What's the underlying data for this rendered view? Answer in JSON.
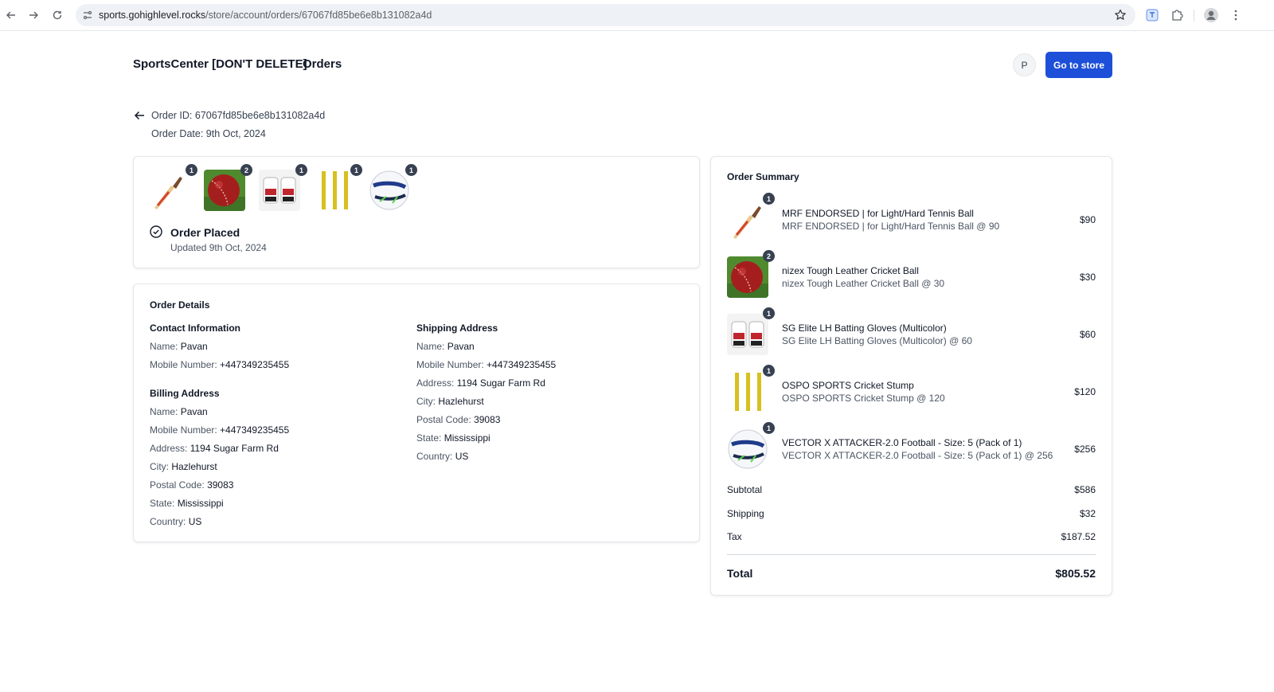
{
  "browser": {
    "url_host": "sports.gohighlevel.rocks",
    "url_path": "/store/account/orders/67067fd85be6e8b131082a4d"
  },
  "header": {
    "brand": "SportsCenter [DON'T DELETE]",
    "orders_link": "Orders",
    "avatar_initial": "P",
    "go_to_store": "Go to store"
  },
  "order": {
    "id_line": "Order ID: 67067fd85be6e8b131082a4d",
    "date_line": "Order Date: 9th Oct, 2024"
  },
  "status": {
    "title": "Order Placed",
    "updated": "Updated 9th Oct, 2024",
    "quantities": [
      "1",
      "2",
      "1",
      "1",
      "1"
    ]
  },
  "details": {
    "title": "Order Details",
    "contact": {
      "heading": "Contact Information",
      "name_label": "Name:",
      "name": "Pavan",
      "mobile_label": "Mobile Number:",
      "mobile": "+447349235455"
    },
    "billing": {
      "heading": "Billing Address",
      "name_label": "Name:",
      "name": "Pavan",
      "mobile_label": "Mobile Number:",
      "mobile": "+447349235455",
      "address_label": "Address:",
      "address": "1194 Sugar Farm Rd",
      "city_label": "City:",
      "city": "Hazlehurst",
      "postal_label": "Postal Code:",
      "postal": "39083",
      "state_label": "State:",
      "state": "Mississippi",
      "country_label": "Country:",
      "country": "US"
    },
    "shipping": {
      "heading": "Shipping Address",
      "name_label": "Name:",
      "name": "Pavan",
      "mobile_label": "Mobile Number:",
      "mobile": "+447349235455",
      "address_label": "Address:",
      "address": "1194 Sugar Farm Rd",
      "city_label": "City:",
      "city": "Hazlehurst",
      "postal_label": "Postal Code:",
      "postal": "39083",
      "state_label": "State:",
      "state": "Mississippi",
      "country_label": "Country:",
      "country": "US"
    }
  },
  "summary": {
    "title": "Order Summary",
    "items": [
      {
        "qty": "1",
        "name": "MRF ENDORSED | for Light/Hard Tennis Ball",
        "sub": "MRF ENDORSED | for Light/Hard Tennis Ball @ 90",
        "price": "$90"
      },
      {
        "qty": "2",
        "name": "nizex Tough Leather Cricket Ball",
        "sub": "nizex Tough Leather Cricket Ball @ 30",
        "price": "$30"
      },
      {
        "qty": "1",
        "name": "SG Elite LH Batting Gloves (Multicolor)",
        "sub": "SG Elite LH Batting Gloves (Multicolor) @ 60",
        "price": "$60"
      },
      {
        "qty": "1",
        "name": "OSPO SPORTS Cricket Stump",
        "sub": "OSPO SPORTS Cricket Stump @ 120",
        "price": "$120"
      },
      {
        "qty": "1",
        "name": "VECTOR X ATTACKER-2.0 Football - Size: 5 (Pack of 1)",
        "sub": "VECTOR X ATTACKER-2.0 Football - Size: 5 (Pack of 1) @ 256",
        "price": "$256"
      }
    ],
    "subtotal_label": "Subtotal",
    "subtotal": "$586",
    "shipping_label": "Shipping",
    "shipping": "$32",
    "tax_label": "Tax",
    "tax": "$187.52",
    "total_label": "Total",
    "total": "$805.52"
  },
  "colors": {
    "primary_button": "#1d4fd8",
    "badge": "#374151"
  }
}
